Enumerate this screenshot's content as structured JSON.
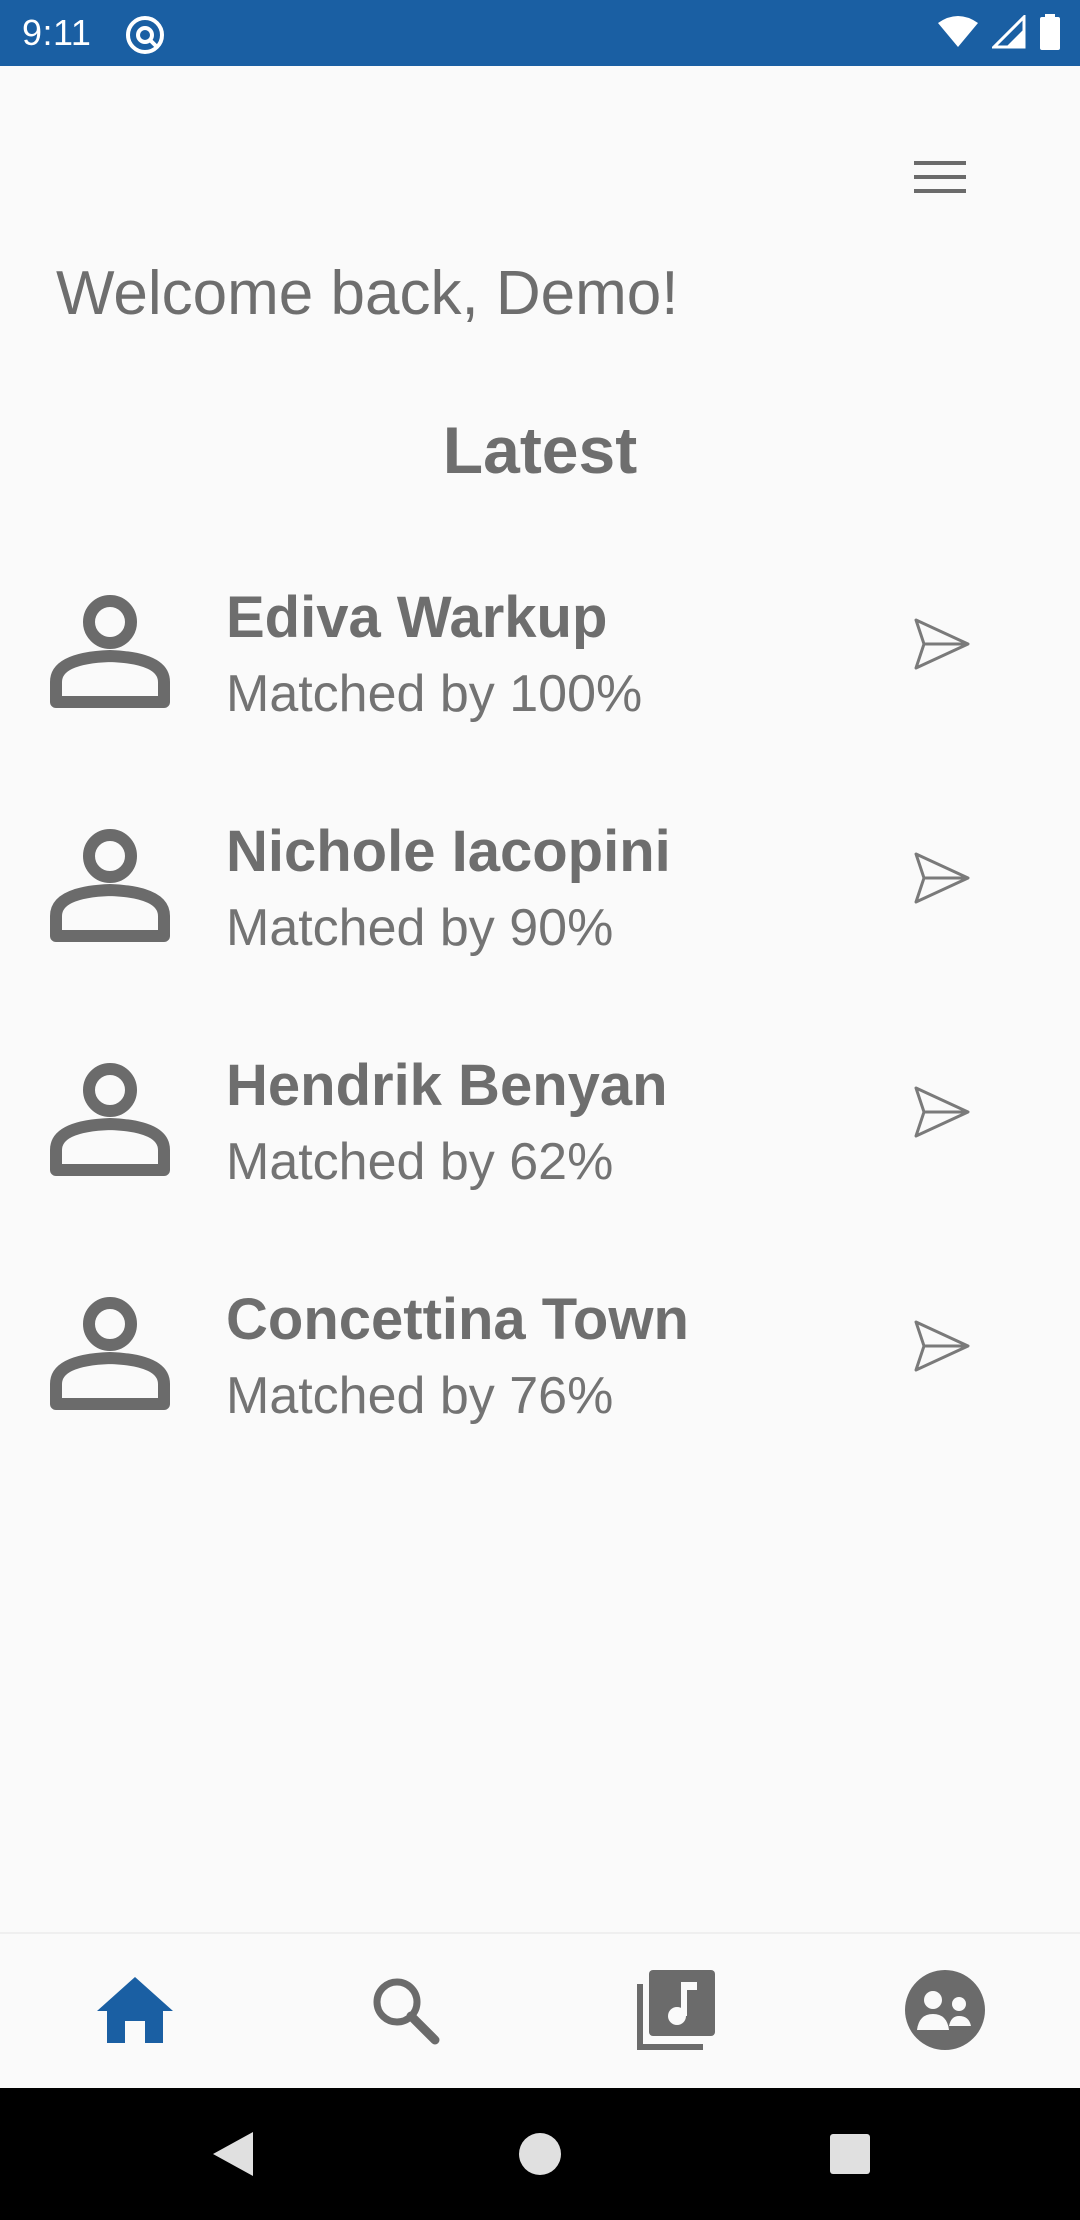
{
  "status_bar": {
    "time": "9:11",
    "background": "#1a5fa3",
    "icons": [
      "at-sign-icon",
      "wifi-icon",
      "signal-icon",
      "battery-icon"
    ]
  },
  "header": {
    "menu_icon": "hamburger-menu-icon"
  },
  "welcome_text": "Welcome back, Demo!",
  "section_title": "Latest",
  "matches": [
    {
      "name": "Ediva Warkup",
      "score": "Matched by 100%"
    },
    {
      "name": "Nichole Iacopini",
      "score": "Matched by 90%"
    },
    {
      "name": "Hendrik Benyan",
      "score": "Matched by 62%"
    },
    {
      "name": "Concettina Town",
      "score": "Matched by 76%"
    }
  ],
  "bottom_nav": {
    "items": [
      {
        "icon": "home-icon",
        "active": true
      },
      {
        "icon": "search-icon",
        "active": false
      },
      {
        "icon": "music-library-icon",
        "active": false
      },
      {
        "icon": "groups-icon",
        "active": false
      }
    ],
    "active_color": "#1a5fa3",
    "inactive_color": "#6b6b6b"
  },
  "system_nav": {
    "icons": [
      "back-icon",
      "home-circle-icon",
      "recents-icon"
    ]
  }
}
